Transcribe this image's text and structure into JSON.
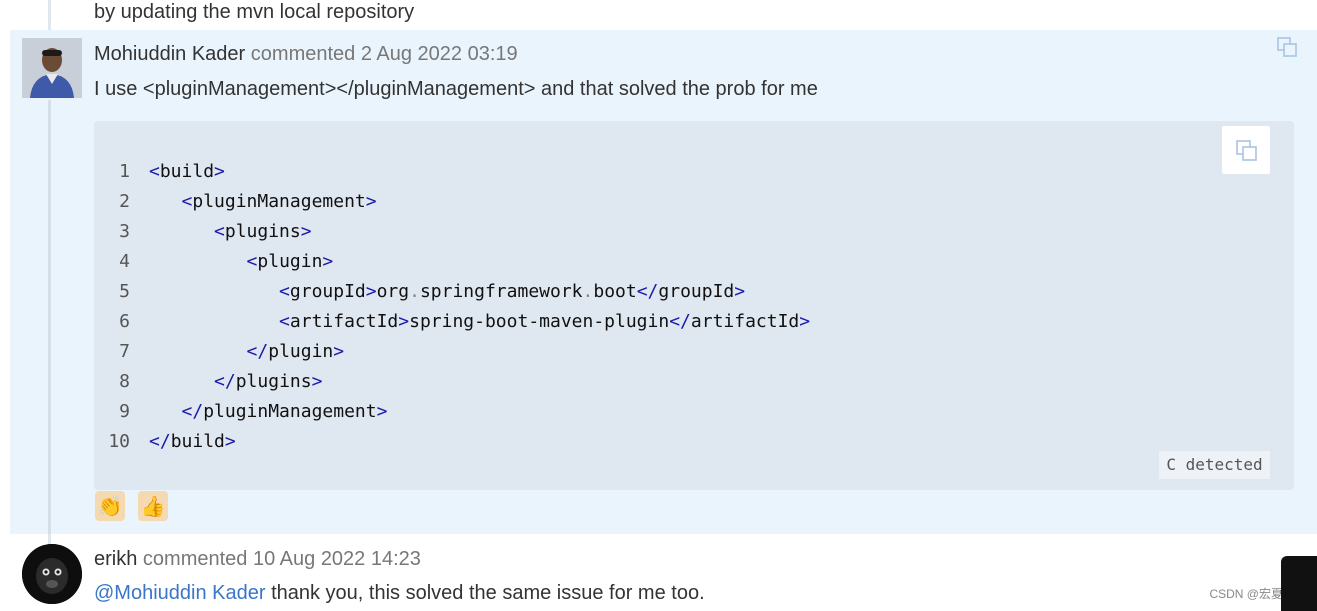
{
  "previous_comment": {
    "text": "by updating the mvn local repository"
  },
  "comment1": {
    "author": "Mohiuddin Kader",
    "meta": "commented 2 Aug 2022 03:19",
    "body": "I use <pluginManagement></pluginManagement> and that solved the prob for me",
    "code_lines": [
      {
        "n": "1",
        "parts": [
          [
            "tag",
            "<"
          ],
          [
            "txt",
            "build"
          ],
          [
            "tag",
            ">"
          ]
        ]
      },
      {
        "n": "2",
        "parts": [
          [
            "txt",
            "   "
          ],
          [
            "tag",
            "<"
          ],
          [
            "txt",
            "pluginManagement"
          ],
          [
            "tag",
            ">"
          ]
        ]
      },
      {
        "n": "3",
        "parts": [
          [
            "txt",
            "      "
          ],
          [
            "tag",
            "<"
          ],
          [
            "txt",
            "plugins"
          ],
          [
            "tag",
            ">"
          ]
        ]
      },
      {
        "n": "4",
        "parts": [
          [
            "txt",
            "         "
          ],
          [
            "tag",
            "<"
          ],
          [
            "txt",
            "plugin"
          ],
          [
            "tag",
            ">"
          ]
        ]
      },
      {
        "n": "5",
        "parts": [
          [
            "txt",
            "            "
          ],
          [
            "tag",
            "<"
          ],
          [
            "txt",
            "groupId"
          ],
          [
            "tag",
            ">"
          ],
          [
            "txt",
            "org"
          ],
          [
            "dot",
            "."
          ],
          [
            "txt",
            "springframework"
          ],
          [
            "dot",
            "."
          ],
          [
            "txt",
            "boot"
          ],
          [
            "tag",
            "</"
          ],
          [
            "txt",
            "groupId"
          ],
          [
            "tag",
            ">"
          ]
        ]
      },
      {
        "n": "6",
        "parts": [
          [
            "txt",
            "            "
          ],
          [
            "tag",
            "<"
          ],
          [
            "txt",
            "artifactId"
          ],
          [
            "tag",
            ">"
          ],
          [
            "txt",
            "spring-boot-maven-plugin"
          ],
          [
            "tag",
            "</"
          ],
          [
            "txt",
            "artifactId"
          ],
          [
            "tag",
            ">"
          ]
        ]
      },
      {
        "n": "7",
        "parts": [
          [
            "txt",
            "         "
          ],
          [
            "tag",
            "</"
          ],
          [
            "txt",
            "plugin"
          ],
          [
            "tag",
            ">"
          ]
        ]
      },
      {
        "n": "8",
        "parts": [
          [
            "txt",
            "      "
          ],
          [
            "tag",
            "</"
          ],
          [
            "txt",
            "plugins"
          ],
          [
            "tag",
            ">"
          ]
        ]
      },
      {
        "n": "9",
        "parts": [
          [
            "txt",
            "   "
          ],
          [
            "tag",
            "</"
          ],
          [
            "txt",
            "pluginManagement"
          ],
          [
            "tag",
            ">"
          ]
        ]
      },
      {
        "n": "10",
        "parts": [
          [
            "tag",
            "</"
          ],
          [
            "txt",
            "build"
          ],
          [
            "tag",
            ">"
          ]
        ]
      }
    ],
    "language_badge": "C detected",
    "reactions": [
      "👏",
      "👍"
    ]
  },
  "comment2": {
    "author": "erikh",
    "meta": "commented 10 Aug 2022 14:23",
    "mention": "@Mohiuddin Kader",
    "body": " thank you, this solved the same issue for me too."
  },
  "watermark": "CSDN @宏夏c",
  "icons": {
    "comment_copy": "copy-icon",
    "code_copy": "copy-icon"
  },
  "colors": {
    "highlight_bg": "#eaf4fd",
    "code_bg": "#dfe7f1",
    "tag": "#1a1aa6",
    "mention": "#3a76c8"
  }
}
